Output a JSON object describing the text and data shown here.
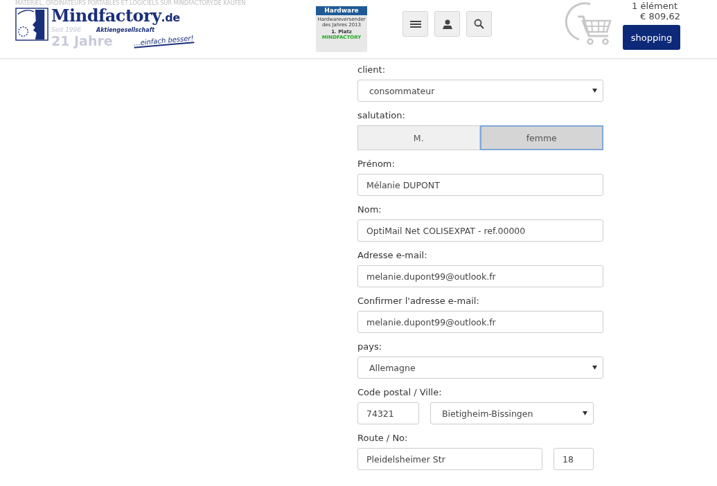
{
  "header": {
    "tagline": "MATÉRIEL, ORDINATEURS PORTABLES ET LOGICIELS SUR MINDFACTORY.DE KAUFEN",
    "logo": {
      "name": "Mindfactory",
      "tld": ".de",
      "since": "Seit 1996",
      "company": "Aktiengesellschaft",
      "years": "21 Jahre",
      "slogan": "...einfach besser!"
    },
    "award": {
      "title": "Hardware",
      "text": "Hardwareversender des Jahres 2013",
      "place": "1. Platz",
      "brand": "MINDFACTORY"
    },
    "cart": {
      "count": "1 élément",
      "total": "€ 809,62",
      "button": "shopping"
    }
  },
  "form": [
    {
      "kind": "select",
      "label": "client:",
      "value": "consommateur"
    },
    {
      "kind": "toggle",
      "label": "salutation:",
      "options": [
        {
          "label": "M.",
          "selected": false
        },
        {
          "label": "femme",
          "selected": true
        }
      ]
    },
    {
      "kind": "text",
      "label": "Prénom:",
      "value": "Mélanie DUPONT"
    },
    {
      "kind": "text",
      "label": "Nom:",
      "value": "OptiMail Net COLISEXPAT - ref.00000"
    },
    {
      "kind": "text",
      "label": "Adresse e-mail:",
      "value": "melanie.dupont99@outlook.fr"
    },
    {
      "kind": "text",
      "label": "Confirmer l'adresse e-mail:",
      "value": "melanie.dupont99@outlook.fr"
    },
    {
      "kind": "select",
      "label": "pays:",
      "value": "Allemagne"
    },
    {
      "kind": "postal",
      "label": "Code postal / Ville:",
      "zip": "74321",
      "city": "Bietigheim-Bissingen"
    },
    {
      "kind": "street",
      "label": "Route / No:",
      "street": "Pleidelsheimer Str",
      "number": "18"
    }
  ]
}
